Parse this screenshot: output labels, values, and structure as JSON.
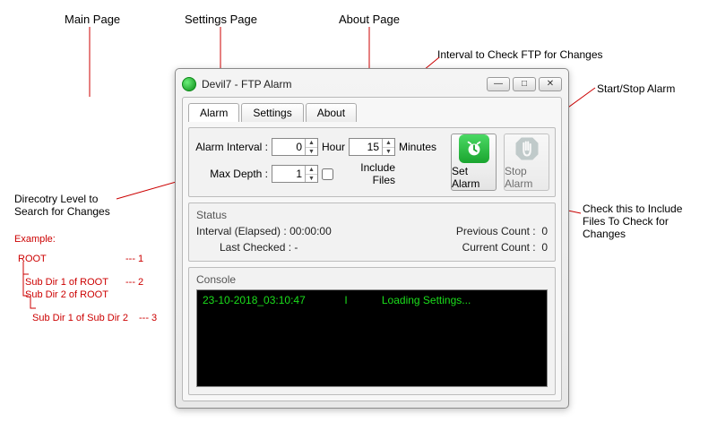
{
  "annotations": {
    "main_page": "Main Page",
    "settings_page": "Settings Page",
    "about_page": "About Page",
    "interval_label": "Interval to Check FTP for Changes",
    "startstop_label": "Start/Stop Alarm",
    "dir_level_label": "Direcotry Level to\nSearch for Changes",
    "include_files_label": "Check this to Include\nFiles To Check for\nChanges",
    "example_title": "Example:",
    "ex_root": "ROOT",
    "ex_sub1": "Sub Dir 1 of ROOT",
    "ex_sub2": "Sub Dir 2 of ROOT",
    "ex_sub3": "Sub Dir 1 of Sub Dir 2",
    "lvl1": "--- 1",
    "lvl2": "--- 2",
    "lvl3": "--- 3"
  },
  "window": {
    "title": "Devil7 - FTP Alarm",
    "tabs": {
      "alarm": "Alarm",
      "settings": "Settings",
      "about": "About"
    },
    "form": {
      "interval_label": "Alarm Interval :",
      "hour_value": "0",
      "hour_unit": "Hour",
      "min_value": "15",
      "min_unit": "Minutes",
      "depth_label": "Max Depth :",
      "depth_value": "1",
      "include_files": "Include Files"
    },
    "buttons": {
      "set": "Set Alarm",
      "stop": "Stop Alarm"
    },
    "status": {
      "title": "Status",
      "interval_elapsed_label": "Interval (Elapsed) :",
      "interval_elapsed_value": "00:00:00",
      "last_checked_label": "Last Checked :",
      "last_checked_value": "-",
      "prev_count_label": "Previous Count :",
      "prev_count_value": "0",
      "curr_count_label": "Current Count :",
      "curr_count_value": "0"
    },
    "console": {
      "title": "Console",
      "ts": "23-10-2018_03:10:47",
      "level": "I",
      "msg": "Loading Settings..."
    }
  }
}
